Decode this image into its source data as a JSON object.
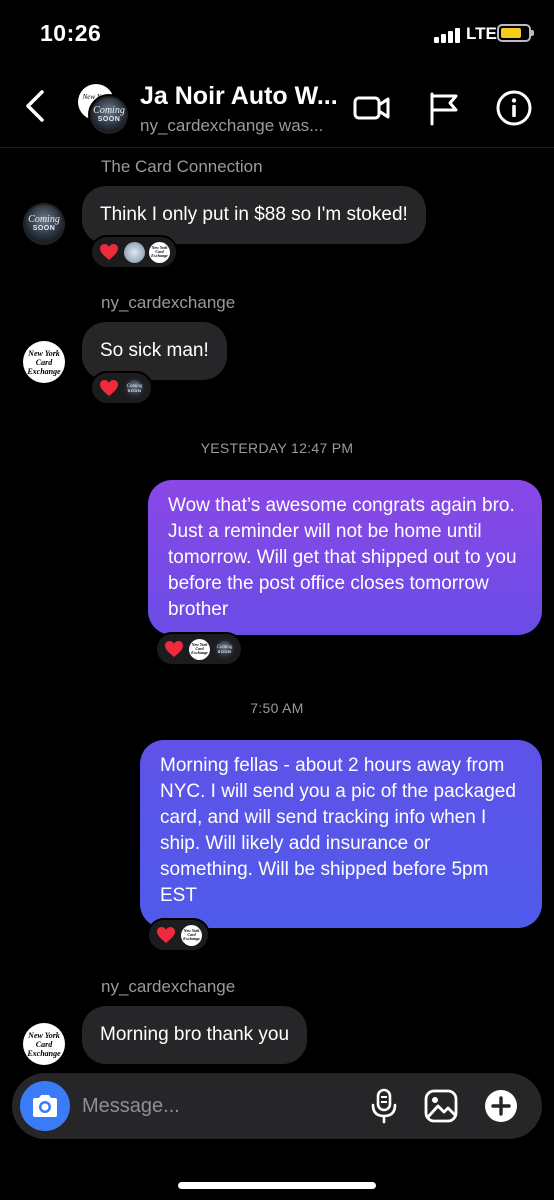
{
  "status_bar": {
    "time": "10:26",
    "network": "LTE",
    "battery_color": "#f5cc1a"
  },
  "header": {
    "title": "Ja Noir Auto W...",
    "subtitle": "ny_cardexchange was...",
    "icons": [
      "back-chevron-icon",
      "video-call-icon",
      "flag-icon",
      "info-icon"
    ]
  },
  "avatars": {
    "coming_soon": {
      "line1": "Coming",
      "line2": "SOON"
    },
    "nyce": {
      "line1": "New York",
      "line2": "Card Exchange"
    }
  },
  "messages": [
    {
      "sender": "The Card Connection",
      "text": "Think I only put in $88 so I'm stoked!",
      "direction": "incoming",
      "reactions": [
        "heart",
        "card-connection-avatar",
        "nyce-avatar"
      ]
    },
    {
      "sender": "ny_cardexchange",
      "text": "So sick man!",
      "direction": "incoming",
      "reactions": [
        "heart",
        "coming-soon-avatar"
      ]
    },
    {
      "text": "Wow that’s awesome congrats again bro. Just a reminder will not be home until tomorrow. Will get that shipped out to you before the post office closes tomorrow brother",
      "direction": "outgoing",
      "reactions": [
        "heart",
        "nyce-avatar",
        "coming-soon-avatar"
      ]
    },
    {
      "text": "Morning fellas - about 2 hours away from NYC. I will send you a pic of the packaged card, and will send tracking info when I ship. Will likely add insurance or something. Will be shipped before 5pm EST",
      "direction": "outgoing",
      "reactions": [
        "heart",
        "nyce-avatar"
      ]
    },
    {
      "sender": "ny_cardexchange",
      "text": "Morning bro thank you",
      "direction": "incoming",
      "reactions": []
    }
  ],
  "timestamps": [
    "YESTERDAY 12:47 PM",
    "7:50 AM"
  ],
  "composer": {
    "placeholder": "Message...",
    "icons": [
      "camera-icon",
      "microphone-icon",
      "gallery-icon",
      "plus-icon"
    ]
  },
  "colors": {
    "incoming_bubble": "#262628",
    "outgoing_gradient_purple": "#8a48e6",
    "outgoing_gradient_blue": "#4f5bea",
    "camera_button": "#3a7bf6"
  }
}
